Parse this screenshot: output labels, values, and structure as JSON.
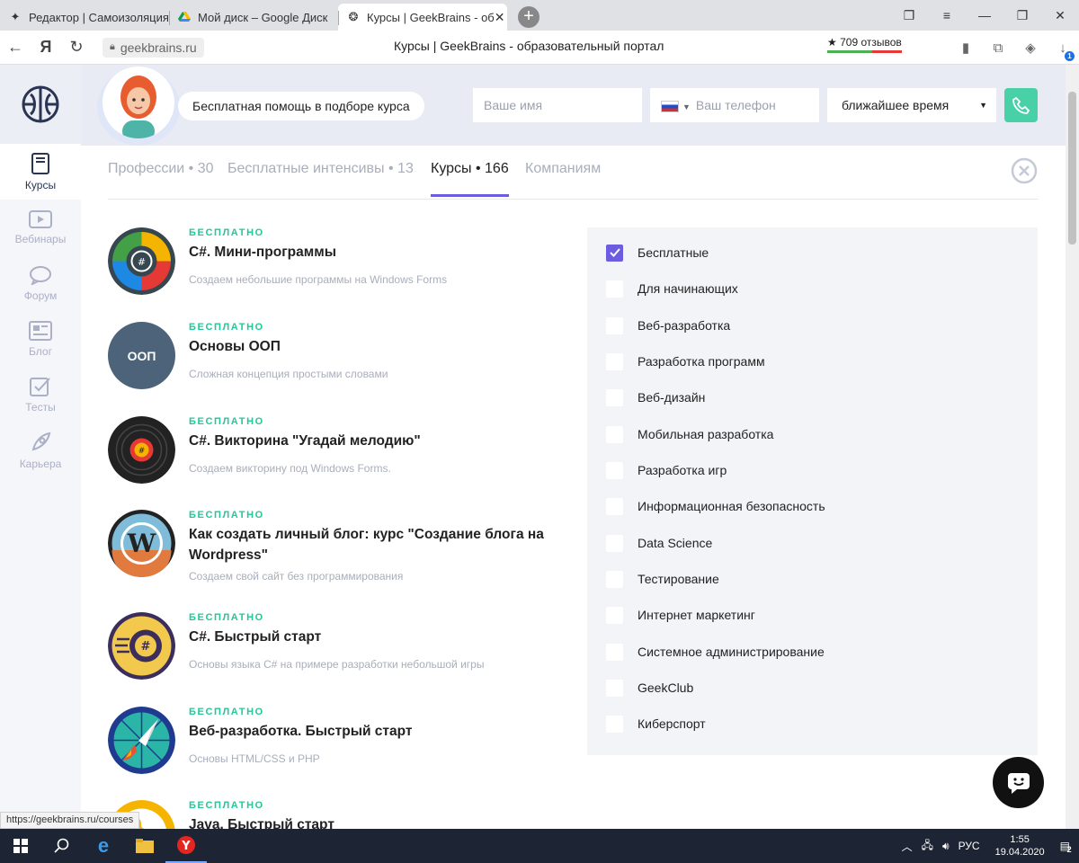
{
  "browser": {
    "tabs": [
      {
        "title": "Редактор | Самоизоляция",
        "icon": "sparkle-icon"
      },
      {
        "title": "Мой диск – Google Диск",
        "icon": "google-drive-icon"
      },
      {
        "title": "Курсы | GeekBrains - об",
        "icon": "geekbrains-icon",
        "active": true
      }
    ],
    "url": "geekbrains.ru",
    "page_title": "Курсы | GeekBrains - образовательный портал",
    "reviews": "★ 709 отзывов",
    "download_badge": "1",
    "status_url": "https://geekbrains.ru/courses"
  },
  "sidebar": {
    "items": [
      {
        "label": "Курсы",
        "icon": "book-icon",
        "active": true
      },
      {
        "label": "Вебинары",
        "icon": "video-icon"
      },
      {
        "label": "Форум",
        "icon": "chat-bubble-icon"
      },
      {
        "label": "Блог",
        "icon": "newspaper-icon"
      },
      {
        "label": "Тесты",
        "icon": "checkbox-icon"
      },
      {
        "label": "Карьера",
        "icon": "rocket-icon"
      }
    ]
  },
  "banner": {
    "help_text": "Бесплатная помощь в подборе курса",
    "name_placeholder": "Ваше имя",
    "phone_placeholder": "Ваш телефон",
    "time_select": "ближайшее время"
  },
  "content_tabs": [
    {
      "label": "Профессии • 30"
    },
    {
      "label": "Бесплатные интенсивы • 13"
    },
    {
      "label": "Курсы • 166",
      "active": true
    },
    {
      "label": "Компаниям"
    }
  ],
  "courses": [
    {
      "badge": "БЕСПЛАТНО",
      "title": "C#. Мини-программы",
      "desc": "Создаем небольшие программы на Windows Forms"
    },
    {
      "badge": "БЕСПЛАТНО",
      "title": "Основы ООП",
      "desc": "Сложная концепция простыми словами",
      "icon_text": "ООП"
    },
    {
      "badge": "БЕСПЛАТНО",
      "title": "C#. Викторина \"Угадай мелодию\"",
      "desc": "Создаем викторину под Windows Forms."
    },
    {
      "badge": "БЕСПЛАТНО",
      "title": "Как создать личный блог: курс \"Создание блога на Wordpress\"",
      "desc": "Создаем свой сайт без программирования"
    },
    {
      "badge": "БЕСПЛАТНО",
      "title": "C#. Быстрый старт",
      "desc": "Основы языка C# на примере разработки небольшой игры"
    },
    {
      "badge": "БЕСПЛАТНО",
      "title": "Веб-разработка. Быстрый старт",
      "desc": "Основы HTML/CSS и PHP"
    },
    {
      "badge": "БЕСПЛАТНО",
      "title": "Java. Быстрый старт",
      "desc": ""
    }
  ],
  "filters": [
    {
      "label": "Бесплатные",
      "checked": true
    },
    {
      "label": "Для начинающих",
      "checked": false
    },
    {
      "label": "Веб-разработка",
      "checked": false
    },
    {
      "label": "Разработка программ",
      "checked": false
    },
    {
      "label": "Веб-дизайн",
      "checked": false
    },
    {
      "label": "Мобильная разработка",
      "checked": false
    },
    {
      "label": "Разработка игр",
      "checked": false
    },
    {
      "label": "Информационная безопасность",
      "checked": false
    },
    {
      "label": "Data Science",
      "checked": false
    },
    {
      "label": "Тестирование",
      "checked": false
    },
    {
      "label": "Интернет маркетинг",
      "checked": false
    },
    {
      "label": "Системное администрирование",
      "checked": false
    },
    {
      "label": "GeekClub",
      "checked": false
    },
    {
      "label": "Киберспорт",
      "checked": false
    }
  ],
  "taskbar": {
    "lang": "РУС",
    "time": "1:55",
    "date": "19.04.2020",
    "notifications": "2"
  },
  "colors": {
    "accent": "#6c5de0",
    "badge": "#20c997",
    "call": "#48d1a6"
  }
}
